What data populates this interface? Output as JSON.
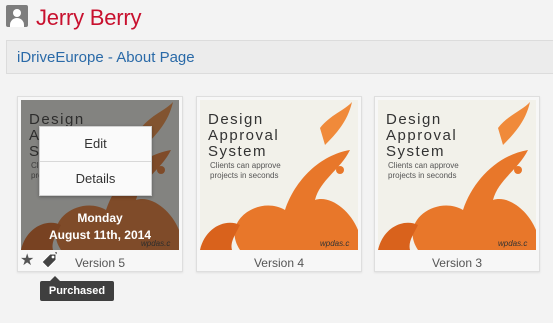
{
  "user": {
    "name": "Jerry Berry",
    "avatar_icon": "user-icon"
  },
  "breadcrumb": {
    "label": "iDriveEurope - About Page"
  },
  "artwork": {
    "title_line1": "Design",
    "title_line2": "Approval",
    "title_line3": "System",
    "tagline_line1": "Clients can approve",
    "tagline_line2": "projects in seconds",
    "watermark": "wpdas.c"
  },
  "versions": [
    {
      "label": "Version 5",
      "menu": {
        "edit": "Edit",
        "details": "Details"
      },
      "date_line1": "Monday",
      "date_line2": "August 11th, 2014",
      "star_icon": "star-icon",
      "tag_icon": "price-tag-icon",
      "tooltip": "Purchased"
    },
    {
      "label": "Version 4"
    },
    {
      "label": "Version 3"
    }
  ],
  "colors": {
    "user_name": "#c8102e",
    "link": "#2a6aa8",
    "splash": "#e8772a"
  }
}
